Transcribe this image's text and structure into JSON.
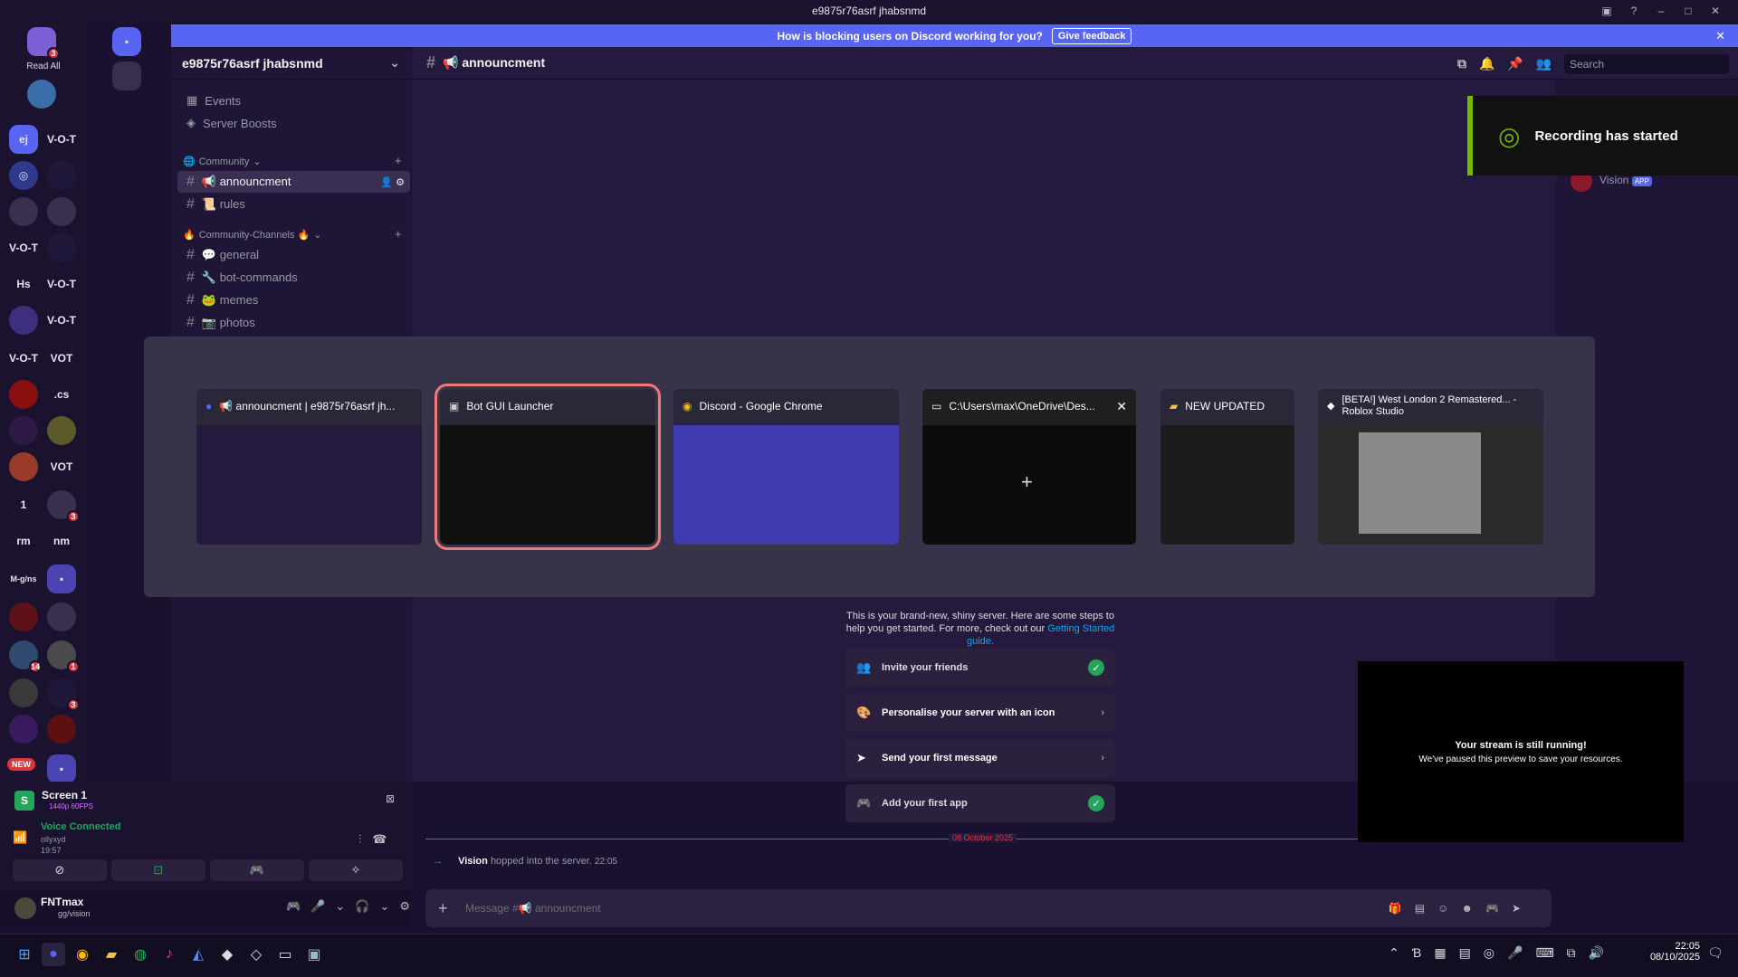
{
  "window": {
    "title": "e9875r76asrf jhabsnmd"
  },
  "banner": {
    "text": "How is blocking users on Discord working for you?",
    "button": "Give feedback"
  },
  "server_list": {
    "read_all": "Read All",
    "read_all_badge": "3",
    "items": [
      {
        "label": "ej",
        "color": "#5865f2"
      },
      {
        "label": "V-O-T"
      },
      {
        "label": "V-O-T"
      },
      {
        "label": "Hs"
      },
      {
        "label": "V-O-T"
      },
      {
        "label": "V-O-T"
      },
      {
        "label": "V-O-T"
      },
      {
        "label": "VOT"
      },
      {
        "label": ".cs"
      },
      {
        "label": "VOT"
      },
      {
        "label": "1"
      },
      {
        "label": "rm"
      },
      {
        "label": "nm"
      },
      {
        "label": "M-g/ns"
      }
    ],
    "badges": [
      "3",
      "14",
      "1",
      "3",
      "NEW"
    ]
  },
  "server": {
    "name": "e9875r76asrf jhabsnmd"
  },
  "sidebar": {
    "top_items": [
      "Events",
      "Server Boosts"
    ],
    "categories": [
      {
        "name": "Community",
        "channels": [
          "📢 announcment",
          "📜 rules"
        ]
      },
      {
        "name": "Community-Channels 🔥",
        "channels": [
          "💬 general",
          "🔧 bot-commands",
          "🐸 memes",
          "📷 photos"
        ]
      }
    ]
  },
  "channel_header": {
    "name": "📢 announcment"
  },
  "search": {
    "placeholder": "Search"
  },
  "switcher": {
    "windows": [
      {
        "title": "📢 announcment | e9875r76asrf jh...",
        "icon": "discord-icon",
        "selected": false
      },
      {
        "title": "Bot GUI Launcher",
        "icon": "app-icon",
        "selected": true
      },
      {
        "title": "Discord - Google Chrome",
        "icon": "chrome-icon",
        "selected": false
      },
      {
        "title": "C:\\Users\\max\\OneDrive\\Des...",
        "icon": "terminal-icon",
        "selected": false
      },
      {
        "title": "NEW UPDATED",
        "icon": "folder-icon",
        "selected": false
      },
      {
        "title": "[BETA!] West London 2 Remastered... - Roblox Studio",
        "icon": "roblox-icon",
        "selected": false
      }
    ]
  },
  "toast": {
    "text": "Recording has started"
  },
  "welcome": {
    "body": "This is your brand-new, shiny server. Here are some steps to help you get started. For more, check out our",
    "link": "Getting Started guide.",
    "tasks": [
      {
        "label": "Invite your friends",
        "done": true
      },
      {
        "label": "Personalise your server with an icon",
        "done": false
      },
      {
        "label": "Send your first message",
        "done": false
      },
      {
        "label": "Add your first app",
        "done": true
      }
    ]
  },
  "divider": {
    "date": "08 October 2025"
  },
  "message": {
    "author": "Vision",
    "text": "hopped into the server.",
    "time": "22:05"
  },
  "composer": {
    "placeholder": "Message #📢 announcment"
  },
  "stream": {
    "title": "Your stream is still running!",
    "subtitle": "We've paused this preview to save your resources."
  },
  "members": {
    "name": "Vision",
    "tag": "APP"
  },
  "voice": {
    "stream_name": "Screen 1",
    "stream_quality": "1440p 60FPS",
    "status": "Voice Connected",
    "channel": "ollyxyd",
    "time": "19:57"
  },
  "user": {
    "name": "FNTmax",
    "status": "gg/vision"
  },
  "taskbar": {
    "time": "22:05",
    "date": "08/10/2025"
  }
}
